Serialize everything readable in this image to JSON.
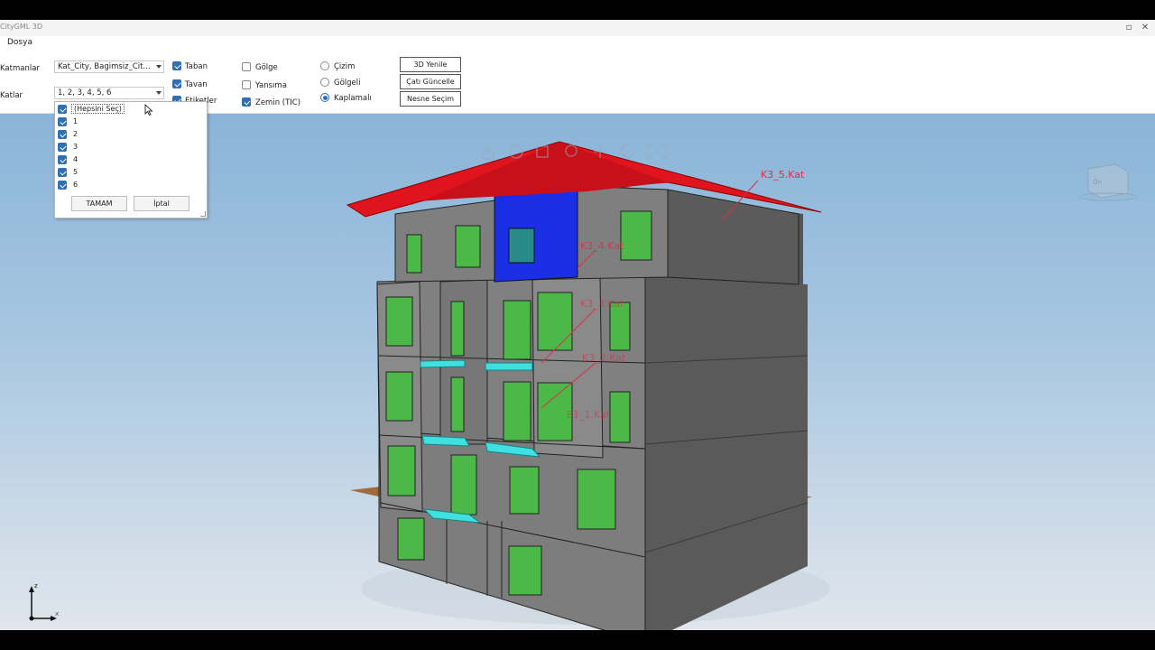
{
  "window": {
    "title": "CityGML 3D"
  },
  "menu": {
    "file": "Dosya"
  },
  "ribbon": {
    "layers_label": "Katmanlar",
    "layers_value": "Kat_City, Bagimsiz_Cit...",
    "floors_label": "Katlar",
    "floors_value": "1, 2, 3, 4, 5, 6",
    "checks": [
      {
        "label": "Taban",
        "checked": true
      },
      {
        "label": "Tavan",
        "checked": true
      },
      {
        "label": "Etiketler",
        "checked": true
      },
      {
        "label": "Gölge",
        "checked": false
      },
      {
        "label": "Yansıma",
        "checked": false
      },
      {
        "label": "Zemin (TIC)",
        "checked": true
      }
    ],
    "radios": [
      {
        "label": "Çizim",
        "selected": false
      },
      {
        "label": "Gölgeli",
        "selected": false
      },
      {
        "label": "Kaplamalı",
        "selected": true
      }
    ],
    "buttons": {
      "refresh3d": "3D Yenile",
      "update_roof": "Çatı Güncelle",
      "object_select": "Nesne Seçim"
    }
  },
  "dropdown": {
    "items": [
      {
        "label": "(Hepsini Seç)",
        "checked": true
      },
      {
        "label": "1",
        "checked": true
      },
      {
        "label": "2",
        "checked": true
      },
      {
        "label": "3",
        "checked": true
      },
      {
        "label": "4",
        "checked": true
      },
      {
        "label": "5",
        "checked": true
      },
      {
        "label": "6",
        "checked": true
      }
    ],
    "ok": "TAMAM",
    "cancel": "İptal"
  },
  "viewport": {
    "labels": [
      "K3_5.Kat",
      "K3_4.Kat",
      "K3_3.Kat",
      "K3_2.Kat",
      "E1_1.Kat"
    ],
    "axis": {
      "z": "z",
      "x": "x"
    },
    "viewcube_text": "Ön"
  },
  "colors": {
    "roof": "#e0141c",
    "wall": "#7a7a7a",
    "window": "#4cb848",
    "selected": "#1a2ee6",
    "balcony": "#40e0e0",
    "label": "#d9304a"
  }
}
